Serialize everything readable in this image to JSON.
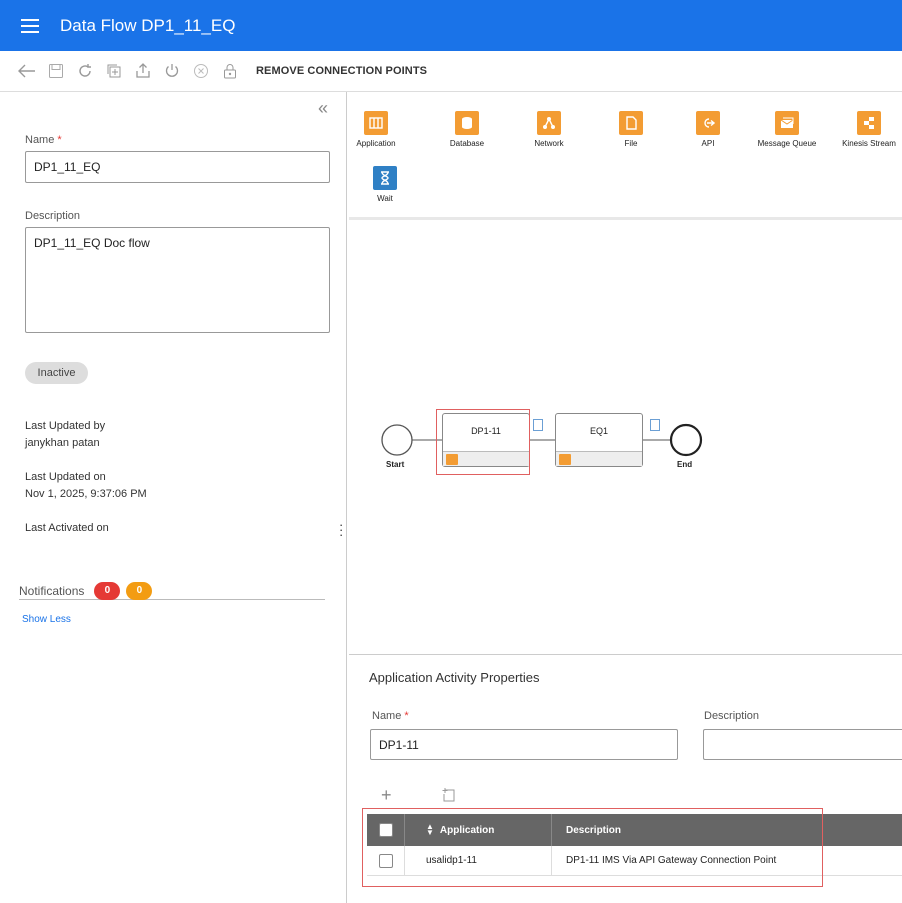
{
  "header": {
    "title": "Data Flow DP1_11_EQ"
  },
  "toolbar": {
    "icons": [
      "back-arrow-icon",
      "save-icon",
      "refresh-icon",
      "copy-icon",
      "export-icon",
      "power-icon",
      "cancel-icon",
      "lock-icon"
    ],
    "remove_label": "REMOVE CONNECTION POINTS"
  },
  "form": {
    "name_label": "Name",
    "name_value": "DP1_11_EQ",
    "description_label": "Description",
    "description_value": "DP1_11_EQ Doc flow",
    "status": "Inactive",
    "last_updated_by_label": "Last Updated by",
    "last_updated_by": "janykhan patan",
    "last_updated_on_label": "Last Updated on",
    "last_updated_on": "Nov 1, 2025, 9:37:06 PM",
    "last_activated_label": "Last Activated on",
    "notifications_label": "Notifications",
    "notif_red": "0",
    "notif_orange": "0",
    "show_less": "Show Less"
  },
  "palette": {
    "items": [
      {
        "label": "Application",
        "icon": "application-icon",
        "color": "#f39c33"
      },
      {
        "label": "Database",
        "icon": "database-icon",
        "color": "#f39c33"
      },
      {
        "label": "Network",
        "icon": "network-icon",
        "color": "#f39c33"
      },
      {
        "label": "File",
        "icon": "file-icon",
        "color": "#f39c33"
      },
      {
        "label": "API",
        "icon": "api-icon",
        "color": "#f39c33"
      },
      {
        "label": "Message Queue",
        "icon": "message-queue-icon",
        "color": "#f39c33"
      },
      {
        "label": "Kinesis Stream",
        "icon": "kinesis-stream-icon",
        "color": "#f39c33"
      },
      {
        "label": "Wait",
        "icon": "wait-icon",
        "color": "#2f80c5"
      }
    ]
  },
  "flow": {
    "start_label": "Start",
    "end_label": "End",
    "node1": "DP1-11",
    "node2": "EQ1"
  },
  "props": {
    "title": "Application Activity Properties",
    "name_label": "Name",
    "name_value": "DP1-11",
    "description_label": "Description",
    "description_value": "",
    "table": {
      "col_application": "Application",
      "col_description": "Description",
      "rows": [
        {
          "application": "usalidp1-11",
          "description": "DP1-11 IMS Via API Gateway Connection Point"
        }
      ]
    }
  },
  "colors": {
    "accent": "#1a73e8",
    "orange": "#f39c33",
    "red": "#e53935",
    "blue_wait": "#2f80c5"
  }
}
